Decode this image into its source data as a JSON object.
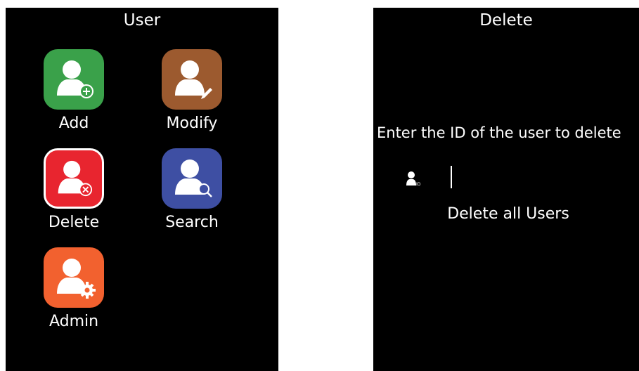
{
  "user_screen": {
    "title": "User",
    "apps": [
      {
        "label": "Add",
        "icon": "user-add-icon",
        "color": "#3aa14a"
      },
      {
        "label": "Modify",
        "icon": "user-edit-icon",
        "color": "#9c5a2f"
      },
      {
        "label": "Delete",
        "icon": "user-delete-icon",
        "color": "#e8252f"
      },
      {
        "label": "Search",
        "icon": "user-search-icon",
        "color": "#3e4fa3"
      },
      {
        "label": "Admin",
        "icon": "user-admin-icon",
        "color": "#f2612f"
      }
    ]
  },
  "delete_screen": {
    "title": "Delete",
    "prompt": "Enter the ID of the user to delete",
    "id_input": {
      "value": "",
      "icon": "user-id-icon"
    },
    "delete_all_label": "Delete all Users"
  }
}
